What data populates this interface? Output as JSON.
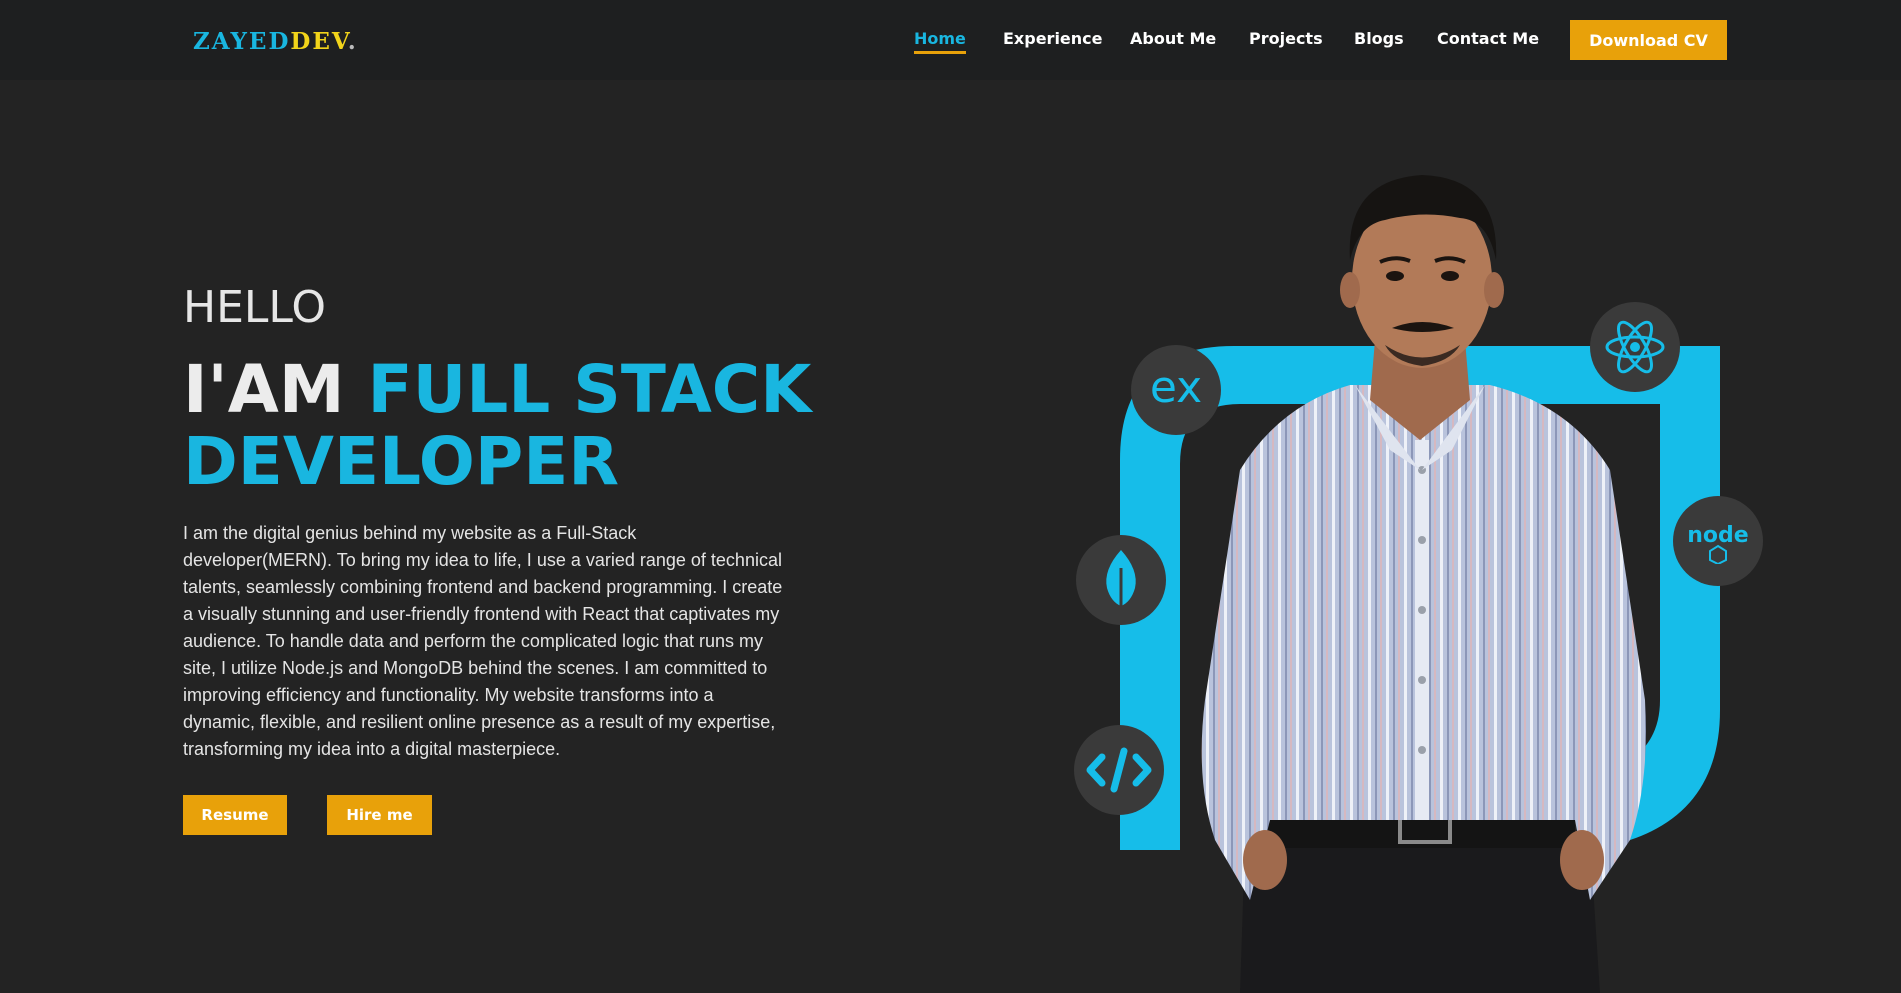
{
  "brand": {
    "logo_part1": "ZAYED",
    "logo_part2": "DEV",
    "logo_part3": "."
  },
  "nav": {
    "items": [
      {
        "label": "Home",
        "active": true
      },
      {
        "label": "Experience",
        "active": false
      },
      {
        "label": "About Me",
        "active": false
      },
      {
        "label": "Projects",
        "active": false
      },
      {
        "label": "Blogs",
        "active": false
      },
      {
        "label": "Contact Me",
        "active": false
      }
    ],
    "download_cv": "Download CV"
  },
  "hero": {
    "greeting": "HELLO",
    "headline_prefix": "I'AM",
    "headline_highlight_1": "FULL STACK",
    "headline_highlight_2": "DEVELOPER",
    "description": "I am the digital genius behind my website as a Full-Stack developer(MERN). To bring my idea to life, I use a varied range of technical talents, seamlessly combining frontend and backend programming. I create a visually stunning and user-friendly frontend with React that captivates my audience. To handle data and perform the complicated logic that runs my site, I utilize Node.js and MongoDB behind the scenes. I am committed to improving efficiency and functionality. My website transforms into a dynamic, flexible, and resilient online presence as a result of my expertise, transforming my idea into a digital masterpiece.",
    "resume_button": "Resume",
    "hire_button": "Hire me"
  },
  "tech_icons": {
    "express_label": "ex",
    "node_label": "node"
  },
  "colors": {
    "background": "#232323",
    "navbar": "#1e1f20",
    "accent_blue": "#19b6e0",
    "accent_orange": "#e8a10a",
    "logo_yellow": "#f2d41a",
    "icon_circle": "#3a3a3a"
  },
  "icons": [
    "express-icon",
    "react-icon",
    "node-icon",
    "mongodb-leaf-icon",
    "code-icon"
  ]
}
